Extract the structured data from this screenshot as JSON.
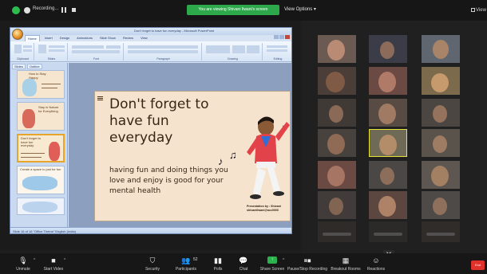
{
  "topbar": {
    "recording_label": "Recording...",
    "share_banner": "You are viewing Shivani Ilwani's screen",
    "view_options": "View Options",
    "view_label": "View"
  },
  "ppt": {
    "window_title": "Don't forget to have fun everyday - Microsoft PowerPoint",
    "tabs": [
      "Home",
      "Insert",
      "Design",
      "Animations",
      "Slide Show",
      "Review",
      "View"
    ],
    "ribbon_groups": [
      "Clipboard",
      "Slides",
      "Font",
      "Paragraph",
      "Drawing",
      "Editing"
    ],
    "side_tabs": [
      "Slides",
      "Outline"
    ],
    "status": "Slide 16 of 16    \"Office Theme\"    English (India)"
  },
  "slide": {
    "title": "Don't forget to have fun everyday",
    "body": "having fun and doing things you love and enjoy is good for your mental health",
    "credit_line1": "Presentation by : Shivani",
    "credit_line2": "shivaniilwani@acc0000"
  },
  "thumbnails": [
    {
      "num": "13",
      "title": "How to Stay Happy"
    },
    {
      "num": "14",
      "title": "Stay in Nature for Everything"
    },
    {
      "num": "15",
      "title": "Don't forget to have fun everyday"
    },
    {
      "num": "16",
      "title": "Create a space to just for fun"
    }
  ],
  "toolbar": {
    "items": [
      {
        "icon": "microphone-icon",
        "label": "Unmute"
      },
      {
        "icon": "video-camera-icon",
        "label": "Start Video"
      },
      {
        "icon": "shield-icon",
        "label": "Security"
      },
      {
        "icon": "participants-icon",
        "label": "Participants",
        "count": "52"
      },
      {
        "icon": "polls-icon",
        "label": "Polls"
      },
      {
        "icon": "chat-icon",
        "label": "Chat"
      },
      {
        "icon": "share-screen-icon",
        "label": "Share Screen"
      },
      {
        "icon": "pause-share-icon",
        "label": "Pause/Stop Recording"
      },
      {
        "icon": "breakout-rooms-icon",
        "label": "Breakout Rooms"
      },
      {
        "icon": "reactions-icon",
        "label": "Reactions"
      }
    ],
    "end_label": "End"
  },
  "colors": {
    "share_green": "#2da84a",
    "end_red": "#e0312a",
    "slide_bg": "#f6e3cd",
    "slide_text": "#3a2514",
    "active_speaker": "#e7e23a"
  }
}
